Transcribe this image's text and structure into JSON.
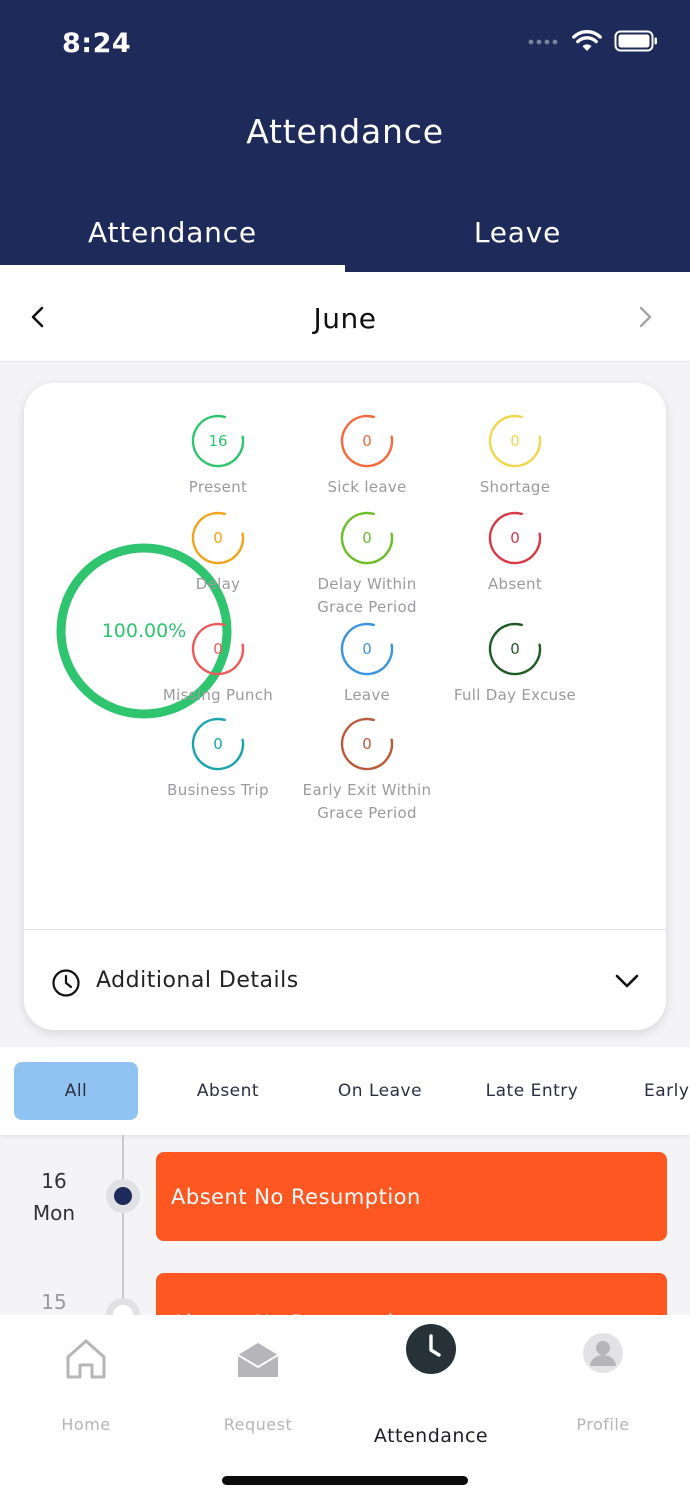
{
  "status_bar": {
    "time": "8:24"
  },
  "header": {
    "title": "Attendance"
  },
  "tabs": [
    {
      "label": "Attendance",
      "active": true
    },
    {
      "label": "Leave",
      "active": false
    }
  ],
  "month_nav": {
    "month": "June"
  },
  "summary": {
    "percentage": "100.00%",
    "percentage_value": 1.0,
    "stats": [
      {
        "value": "16",
        "label": "Present",
        "color": "#2fc46e"
      },
      {
        "value": "0",
        "label": "Sick leave",
        "color": "#f26a3d"
      },
      {
        "value": "0",
        "label": "Shortage",
        "color": "#f2d64b"
      },
      {
        "value": "0",
        "label": "Delay",
        "color": "#f2a31b"
      },
      {
        "value": "0",
        "label": "Delay Within",
        "label2": "Grace Period",
        "color": "#6cbd2a"
      },
      {
        "value": "0",
        "label": "Absent",
        "color": "#d63a47"
      },
      {
        "value": "0",
        "label": "Missing Punch",
        "color": "#ec5a5a"
      },
      {
        "value": "0",
        "label": "Leave",
        "color": "#3b94e0"
      },
      {
        "value": "0",
        "label": "Full Day Excuse",
        "color": "#1f5a24"
      },
      {
        "value": "0",
        "label": "Business Trip",
        "color": "#1aa3ad"
      },
      {
        "value": "0",
        "label": "Early Exit Within",
        "label2": "Grace Period",
        "color": "#b95a3a"
      }
    ],
    "additional_details": "Additional Details"
  },
  "filters": [
    "All",
    "Absent",
    "On Leave",
    "Late Entry",
    "Early"
  ],
  "timeline": [
    {
      "day": "16",
      "weekday": "Mon",
      "status": "Absent No Resumption"
    },
    {
      "day": "15",
      "weekday": "",
      "status": "Absent No Resumption"
    }
  ],
  "bottom_nav": [
    {
      "label": "Home",
      "icon": "home-icon"
    },
    {
      "label": "Request",
      "icon": "envelope-icon"
    },
    {
      "label": "Attendance",
      "icon": "clock-icon",
      "active": true
    },
    {
      "label": "Profile",
      "icon": "profile-icon"
    }
  ],
  "colors": {
    "primary": "#1e2a5a",
    "accent_orange": "#ff5722",
    "chip_active": "#90c3f1",
    "present_green": "#2fc46e"
  }
}
